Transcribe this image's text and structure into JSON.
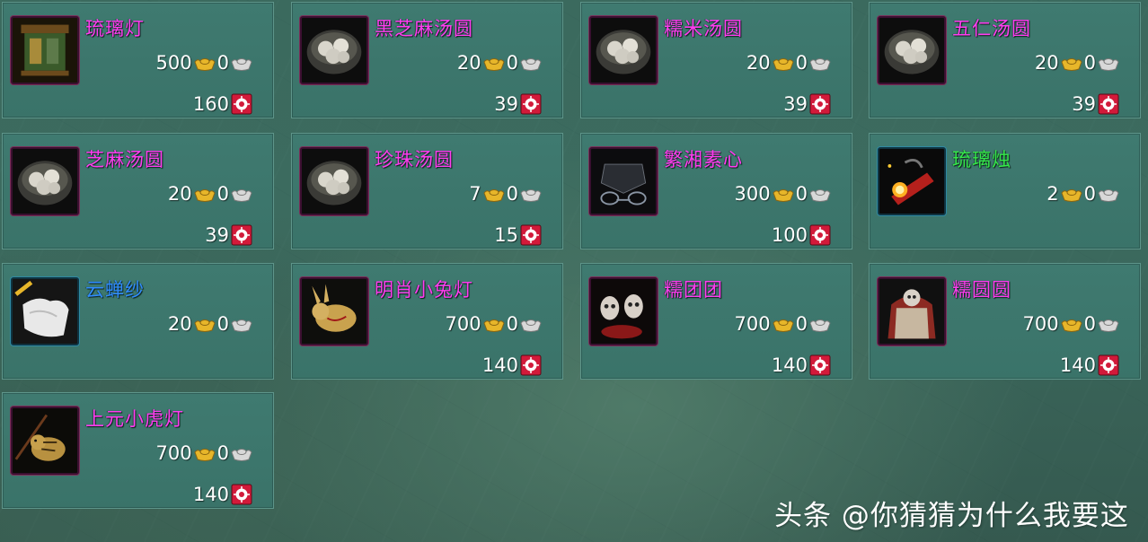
{
  "colors": {
    "magenta_name": "#ff3df0",
    "green_name": "#35e84a",
    "blue_name": "#2f8cff",
    "gold_ingot": "#e7b62a",
    "silver_ingot": "#d8d8d8",
    "badge_red": "#d21a3a"
  },
  "items": [
    {
      "name": "琉璃灯",
      "name_color": "#ff3df0",
      "gold": "500",
      "silver": "0",
      "points": "160",
      "icon": "glass-lantern-icon"
    },
    {
      "name": "黑芝麻汤圆",
      "name_color": "#ff3df0",
      "gold": "20",
      "silver": "0",
      "points": "39",
      "icon": "dumpling-bowl-icon"
    },
    {
      "name": "糯米汤圆",
      "name_color": "#ff3df0",
      "gold": "20",
      "silver": "0",
      "points": "39",
      "icon": "dumpling-bowl-icon"
    },
    {
      "name": "五仁汤圆",
      "name_color": "#ff3df0",
      "gold": "20",
      "silver": "0",
      "points": "39",
      "icon": "dumpling-bowl-icon"
    },
    {
      "name": "芝麻汤圆",
      "name_color": "#ff3df0",
      "gold": "20",
      "silver": "0",
      "points": "39",
      "icon": "dumpling-bowl-icon"
    },
    {
      "name": "珍珠汤圆",
      "name_color": "#ff3df0",
      "gold": "7",
      "silver": "0",
      "points": "15",
      "icon": "dumpling-bowl-icon"
    },
    {
      "name": "繁湘素心",
      "name_color": "#ff3df0",
      "gold": "300",
      "silver": "0",
      "points": "100",
      "icon": "dark-ornament-icon"
    },
    {
      "name": "琉璃烛",
      "name_color": "#35e84a",
      "gold": "2",
      "silver": "0",
      "points": "",
      "icon": "glass-candle-icon"
    },
    {
      "name": "云蝉纱",
      "name_color": "#2f8cff",
      "gold": "20",
      "silver": "0",
      "points": "",
      "icon": "silk-cloth-icon"
    },
    {
      "name": "明肖小兔灯",
      "name_color": "#ff3df0",
      "gold": "700",
      "silver": "0",
      "points": "140",
      "icon": "rabbit-lantern-icon"
    },
    {
      "name": "糯团团",
      "name_color": "#ff3df0",
      "gold": "700",
      "silver": "0",
      "points": "140",
      "icon": "mask-figures-icon"
    },
    {
      "name": "糯圆圆",
      "name_color": "#ff3df0",
      "gold": "700",
      "silver": "0",
      "points": "140",
      "icon": "robed-figure-icon"
    },
    {
      "name": "上元小虎灯",
      "name_color": "#ff3df0",
      "gold": "700",
      "silver": "0",
      "points": "140",
      "icon": "tiger-lantern-icon"
    }
  ],
  "watermark": "头条 @你猜猜为什么我要这"
}
